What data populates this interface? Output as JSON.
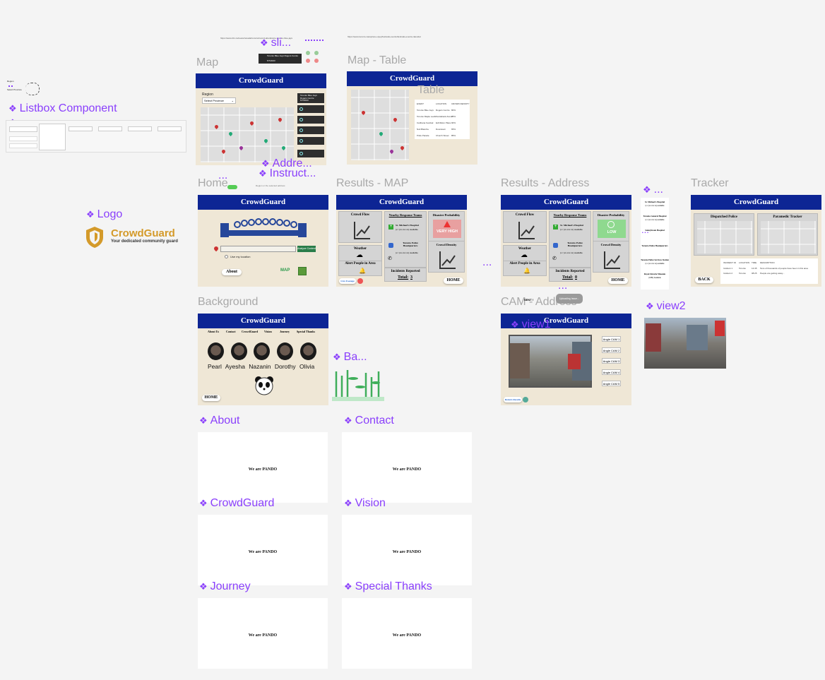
{
  "urls": {
    "url1": "https://www.cbc.ca/news/canada/toronto/record-attendance-toronto-blue-jays",
    "url2": "https://www.toronto.ca/explore-enjoy/festivals-events/festivals-events-calendar"
  },
  "labels": {
    "map": "Map",
    "map_table": "Map - Table",
    "table": "Table",
    "home": "Home",
    "results_map": "Results - MAP",
    "results_address": "Results - Address",
    "tracker": "Tracker",
    "background": "Background",
    "cam_address": "CAM - Address"
  },
  "components": {
    "sli": "sli...",
    "listbox": "Listbox Component",
    "logo": "Logo",
    "addre": "Addre...",
    "instruct": "Instruct...",
    "view1": "view1",
    "view2": "view2",
    "ba": "Ba...",
    "about": "About",
    "contact": "Contact",
    "crowdguard": "CrowdGuard",
    "vision": "Vision",
    "journey": "Journey",
    "special_thanks": "Special Thanks",
    "dots": "...",
    "dotsmall": "..."
  },
  "app": {
    "title": "CrowdGuard",
    "tagline": "Your dedicated community guard"
  },
  "map_frame": {
    "region_label": "Region",
    "region_select": "Select Province",
    "legend_title": "Toronto Blue Jays Rogers Centre",
    "legend_time": "5/7/2023",
    "popup_title": "Toronto Blue Jays Rogers Centre",
    "popup_date": "5/7/2023"
  },
  "table_frame": {
    "columns": [
      "EVENT",
      "LOCATION",
      "CROWD DENSITY"
    ],
    "rows": [
      [
        "Toronto Blue Jays",
        "Rogers Centre",
        "80%"
      ],
      [
        "Toronto Maple Leafs",
        "Scotiabank Arena",
        "75%"
      ],
      [
        "Caribana Festival",
        "Exhibition Place",
        "90%"
      ],
      [
        "Nuit Blanche",
        "Downtown",
        "65%"
      ],
      [
        "Pride Parade",
        "Church Street",
        "85%"
      ]
    ]
  },
  "home_frame": {
    "search_placeholder": "",
    "analyze_button": "Analyze Content",
    "use_location": "Use my location",
    "about_button": "About",
    "map_button": "MAP"
  },
  "results": {
    "crowd_flow": "Crowd Flow",
    "nearby": "Nearby Response Teams",
    "disaster": "Disaster Probability",
    "weather": "Weather",
    "alert": "Alert People in Area",
    "density": "Crowd Density",
    "incidents": "Incidents Reported",
    "total_label": "Total:",
    "hospital": "St. Michael's Hospital",
    "hospital_sub": "(x / (xx.xxx xx) available",
    "police": "Toronto Police Headquarters",
    "police_sub": "(x / (xx.xxx xx) available",
    "live_footage": "Live Footage",
    "home_button": "HOME",
    "map_prob": "VERY HIGH",
    "map_total": "3",
    "address_prob": "LOW",
    "address_total": "0"
  },
  "side_list": {
    "item1": "St. Michael's Hospital",
    "item1_sub": "(x x (xx.xxx xx) available",
    "item2": "Toronto General Hospital",
    "item2_sub": "(x x (xx.xxx xx) available",
    "item3": "Sunnybrook Hospital",
    "item4": "Toronto Police Headquarters",
    "item5": "Toronto Police Services Station",
    "item5_sub": "(x x (xx.xxx xx) available",
    "item6": "Royal Ontario Museum",
    "item6_sub": "(CPR) Available"
  },
  "tracker_frame": {
    "dispatched": "Dispatched Police",
    "paramedic": "Paramedic Tracker",
    "back": "BACK",
    "columns": [
      "INCIDENT ID",
      "LOCATION",
      "TIME",
      "DESCRIPTION"
    ],
    "rows": [
      [
        "Incident 1",
        "Toronto",
        "12:45",
        "Tens of thousands of people have been in this area"
      ],
      [
        "Incident 2",
        "Toronto",
        "08:25",
        "People are getting away..."
      ]
    ]
  },
  "background_frame": {
    "nav": [
      "About Us",
      "Contact",
      "CrowdGuard",
      "Vision",
      "Journey",
      "Special Thanks"
    ],
    "names_line": "Pearl Ayesha Nazanin Dorothy Olivia",
    "home_button": "HOME"
  },
  "cam_frame": {
    "angles": [
      "Angle CAM 1",
      "Angle CAM 2",
      "Angle CAM 3",
      "Angle CAM 4",
      "Angle CAM 5"
    ],
    "return": "Return Results",
    "sent": "SENT !",
    "processing": "Uploading Issue..."
  },
  "white_frames": {
    "text": "We are PANDO"
  },
  "misc": {
    "instruct_note": "Please select a province",
    "instruct_footer": "Region or the selected address"
  },
  "colors": {
    "header": "#0d2594",
    "beige": "#efe7d6",
    "component": "#8a3ffc",
    "logo_gold": "#d49a2a"
  }
}
